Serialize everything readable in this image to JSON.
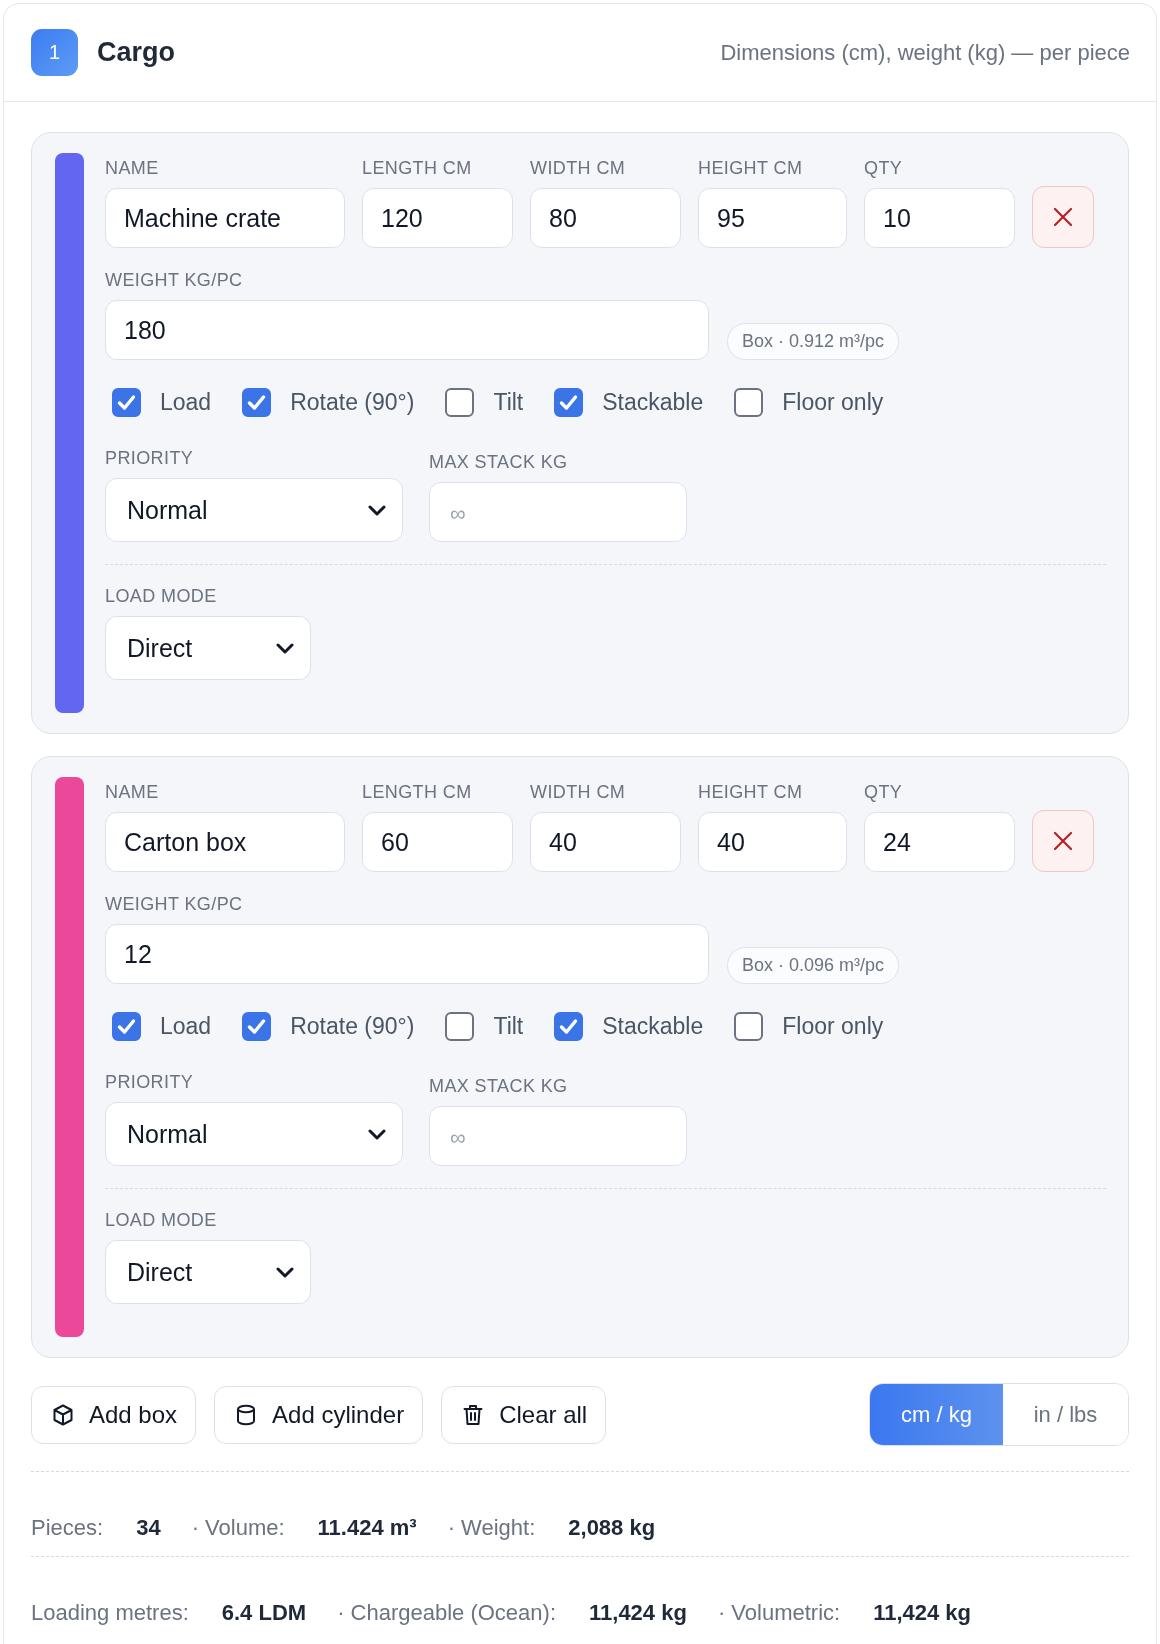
{
  "header": {
    "step": "1",
    "title": "Cargo",
    "note": "Dimensions (cm), weight (kg) — per piece"
  },
  "items": [
    {
      "color": "#6366f1",
      "fields": [
        {
          "label": "NAME",
          "value": "Machine crate"
        },
        {
          "label": "LENGTH CM",
          "value": "120"
        },
        {
          "label": "WIDTH CM",
          "value": "80"
        },
        {
          "label": "HEIGHT CM",
          "value": "95"
        },
        {
          "label": "QTY",
          "value": "10"
        }
      ],
      "weight": {
        "label": "WEIGHT KG/PC",
        "value": "180"
      },
      "volume_badge": "Box · 0.912 m³/pc",
      "options": [
        {
          "label": "Load",
          "checked": true
        },
        {
          "label": "Rotate (90°)",
          "checked": true
        },
        {
          "label": "Tilt",
          "checked": false
        },
        {
          "label": "Stackable",
          "checked": true
        },
        {
          "label": "Floor only",
          "checked": false
        }
      ],
      "priority": {
        "label": "PRIORITY",
        "value": "Normal"
      },
      "max_stack": {
        "label": "MAX STACK KG",
        "placeholder": "∞"
      },
      "load_mode": {
        "label": "LOAD MODE",
        "value": "Direct"
      }
    },
    {
      "color": "#ec4899",
      "fields": [
        {
          "label": "NAME",
          "value": "Carton box"
        },
        {
          "label": "LENGTH CM",
          "value": "60"
        },
        {
          "label": "WIDTH CM",
          "value": "40"
        },
        {
          "label": "HEIGHT CM",
          "value": "40"
        },
        {
          "label": "QTY",
          "value": "24"
        }
      ],
      "weight": {
        "label": "WEIGHT KG/PC",
        "value": "12"
      },
      "volume_badge": "Box · 0.096 m³/pc",
      "options": [
        {
          "label": "Load",
          "checked": true
        },
        {
          "label": "Rotate (90°)",
          "checked": true
        },
        {
          "label": "Tilt",
          "checked": false
        },
        {
          "label": "Stackable",
          "checked": true
        },
        {
          "label": "Floor only",
          "checked": false
        }
      ],
      "priority": {
        "label": "PRIORITY",
        "value": "Normal"
      },
      "max_stack": {
        "label": "MAX STACK KG",
        "placeholder": "∞"
      },
      "load_mode": {
        "label": "LOAD MODE",
        "value": "Direct"
      }
    }
  ],
  "actions": [
    {
      "kind": "box",
      "label": "Add box"
    },
    {
      "kind": "cylinder",
      "label": "Add cylinder"
    },
    {
      "kind": "clear",
      "label": "Clear all"
    }
  ],
  "units": [
    {
      "label": "cm / kg",
      "selected": true
    },
    {
      "label": "in / lbs",
      "selected": false
    }
  ],
  "summary": [
    [
      {
        "label": "Pieces:",
        "value": "34"
      },
      {
        "label": "· Volume:",
        "value": "11.424 m³"
      },
      {
        "label": "· Weight:",
        "value": "2,088 kg"
      }
    ],
    [
      {
        "label": "Loading metres:",
        "value": "6.4 LDM"
      },
      {
        "label": "· Chargeable (Ocean):",
        "value": "11,424 kg"
      },
      {
        "label": "· Volumetric:",
        "value": "11,424 kg"
      }
    ]
  ]
}
